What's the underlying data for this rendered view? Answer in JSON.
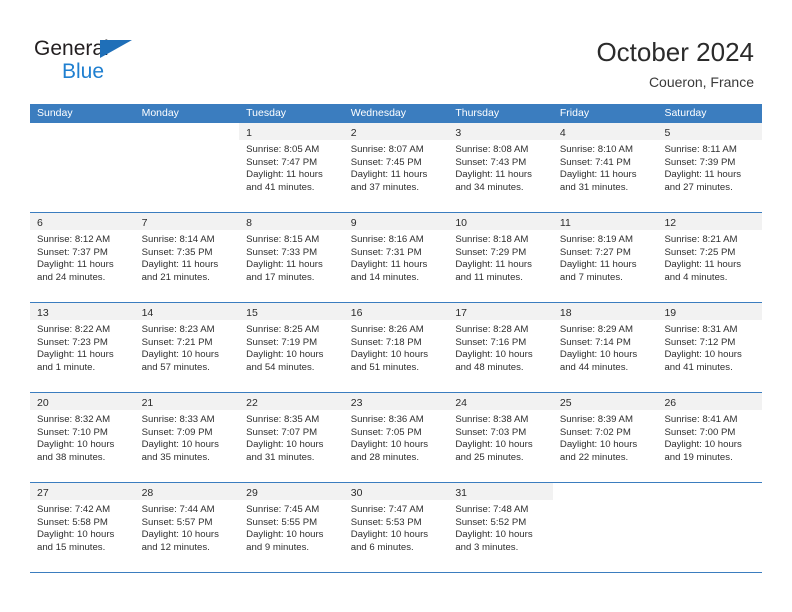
{
  "brand": {
    "name_part1": "General",
    "name_part2": "Blue",
    "triangle_color": "#1f6fb8",
    "blue_text_color": "#1f7fd0"
  },
  "header": {
    "title": "October 2024",
    "location": "Coueron, France"
  },
  "theme": {
    "header_blue": "#3b7dbf",
    "daynum_band": "#f2f2f2",
    "text": "#2f2f2f"
  },
  "weekdays": [
    "Sunday",
    "Monday",
    "Tuesday",
    "Wednesday",
    "Thursday",
    "Friday",
    "Saturday"
  ],
  "weeks": [
    [
      {
        "day": "",
        "sunrise": "",
        "sunset": "",
        "daylight1": "",
        "daylight2": ""
      },
      {
        "day": "",
        "sunrise": "",
        "sunset": "",
        "daylight1": "",
        "daylight2": ""
      },
      {
        "day": "1",
        "sunrise": "Sunrise: 8:05 AM",
        "sunset": "Sunset: 7:47 PM",
        "daylight1": "Daylight: 11 hours",
        "daylight2": "and 41 minutes."
      },
      {
        "day": "2",
        "sunrise": "Sunrise: 8:07 AM",
        "sunset": "Sunset: 7:45 PM",
        "daylight1": "Daylight: 11 hours",
        "daylight2": "and 37 minutes."
      },
      {
        "day": "3",
        "sunrise": "Sunrise: 8:08 AM",
        "sunset": "Sunset: 7:43 PM",
        "daylight1": "Daylight: 11 hours",
        "daylight2": "and 34 minutes."
      },
      {
        "day": "4",
        "sunrise": "Sunrise: 8:10 AM",
        "sunset": "Sunset: 7:41 PM",
        "daylight1": "Daylight: 11 hours",
        "daylight2": "and 31 minutes."
      },
      {
        "day": "5",
        "sunrise": "Sunrise: 8:11 AM",
        "sunset": "Sunset: 7:39 PM",
        "daylight1": "Daylight: 11 hours",
        "daylight2": "and 27 minutes."
      }
    ],
    [
      {
        "day": "6",
        "sunrise": "Sunrise: 8:12 AM",
        "sunset": "Sunset: 7:37 PM",
        "daylight1": "Daylight: 11 hours",
        "daylight2": "and 24 minutes."
      },
      {
        "day": "7",
        "sunrise": "Sunrise: 8:14 AM",
        "sunset": "Sunset: 7:35 PM",
        "daylight1": "Daylight: 11 hours",
        "daylight2": "and 21 minutes."
      },
      {
        "day": "8",
        "sunrise": "Sunrise: 8:15 AM",
        "sunset": "Sunset: 7:33 PM",
        "daylight1": "Daylight: 11 hours",
        "daylight2": "and 17 minutes."
      },
      {
        "day": "9",
        "sunrise": "Sunrise: 8:16 AM",
        "sunset": "Sunset: 7:31 PM",
        "daylight1": "Daylight: 11 hours",
        "daylight2": "and 14 minutes."
      },
      {
        "day": "10",
        "sunrise": "Sunrise: 8:18 AM",
        "sunset": "Sunset: 7:29 PM",
        "daylight1": "Daylight: 11 hours",
        "daylight2": "and 11 minutes."
      },
      {
        "day": "11",
        "sunrise": "Sunrise: 8:19 AM",
        "sunset": "Sunset: 7:27 PM",
        "daylight1": "Daylight: 11 hours",
        "daylight2": "and 7 minutes."
      },
      {
        "day": "12",
        "sunrise": "Sunrise: 8:21 AM",
        "sunset": "Sunset: 7:25 PM",
        "daylight1": "Daylight: 11 hours",
        "daylight2": "and 4 minutes."
      }
    ],
    [
      {
        "day": "13",
        "sunrise": "Sunrise: 8:22 AM",
        "sunset": "Sunset: 7:23 PM",
        "daylight1": "Daylight: 11 hours",
        "daylight2": "and 1 minute."
      },
      {
        "day": "14",
        "sunrise": "Sunrise: 8:23 AM",
        "sunset": "Sunset: 7:21 PM",
        "daylight1": "Daylight: 10 hours",
        "daylight2": "and 57 minutes."
      },
      {
        "day": "15",
        "sunrise": "Sunrise: 8:25 AM",
        "sunset": "Sunset: 7:19 PM",
        "daylight1": "Daylight: 10 hours",
        "daylight2": "and 54 minutes."
      },
      {
        "day": "16",
        "sunrise": "Sunrise: 8:26 AM",
        "sunset": "Sunset: 7:18 PM",
        "daylight1": "Daylight: 10 hours",
        "daylight2": "and 51 minutes."
      },
      {
        "day": "17",
        "sunrise": "Sunrise: 8:28 AM",
        "sunset": "Sunset: 7:16 PM",
        "daylight1": "Daylight: 10 hours",
        "daylight2": "and 48 minutes."
      },
      {
        "day": "18",
        "sunrise": "Sunrise: 8:29 AM",
        "sunset": "Sunset: 7:14 PM",
        "daylight1": "Daylight: 10 hours",
        "daylight2": "and 44 minutes."
      },
      {
        "day": "19",
        "sunrise": "Sunrise: 8:31 AM",
        "sunset": "Sunset: 7:12 PM",
        "daylight1": "Daylight: 10 hours",
        "daylight2": "and 41 minutes."
      }
    ],
    [
      {
        "day": "20",
        "sunrise": "Sunrise: 8:32 AM",
        "sunset": "Sunset: 7:10 PM",
        "daylight1": "Daylight: 10 hours",
        "daylight2": "and 38 minutes."
      },
      {
        "day": "21",
        "sunrise": "Sunrise: 8:33 AM",
        "sunset": "Sunset: 7:09 PM",
        "daylight1": "Daylight: 10 hours",
        "daylight2": "and 35 minutes."
      },
      {
        "day": "22",
        "sunrise": "Sunrise: 8:35 AM",
        "sunset": "Sunset: 7:07 PM",
        "daylight1": "Daylight: 10 hours",
        "daylight2": "and 31 minutes."
      },
      {
        "day": "23",
        "sunrise": "Sunrise: 8:36 AM",
        "sunset": "Sunset: 7:05 PM",
        "daylight1": "Daylight: 10 hours",
        "daylight2": "and 28 minutes."
      },
      {
        "day": "24",
        "sunrise": "Sunrise: 8:38 AM",
        "sunset": "Sunset: 7:03 PM",
        "daylight1": "Daylight: 10 hours",
        "daylight2": "and 25 minutes."
      },
      {
        "day": "25",
        "sunrise": "Sunrise: 8:39 AM",
        "sunset": "Sunset: 7:02 PM",
        "daylight1": "Daylight: 10 hours",
        "daylight2": "and 22 minutes."
      },
      {
        "day": "26",
        "sunrise": "Sunrise: 8:41 AM",
        "sunset": "Sunset: 7:00 PM",
        "daylight1": "Daylight: 10 hours",
        "daylight2": "and 19 minutes."
      }
    ],
    [
      {
        "day": "27",
        "sunrise": "Sunrise: 7:42 AM",
        "sunset": "Sunset: 5:58 PM",
        "daylight1": "Daylight: 10 hours",
        "daylight2": "and 15 minutes."
      },
      {
        "day": "28",
        "sunrise": "Sunrise: 7:44 AM",
        "sunset": "Sunset: 5:57 PM",
        "daylight1": "Daylight: 10 hours",
        "daylight2": "and 12 minutes."
      },
      {
        "day": "29",
        "sunrise": "Sunrise: 7:45 AM",
        "sunset": "Sunset: 5:55 PM",
        "daylight1": "Daylight: 10 hours",
        "daylight2": "and 9 minutes."
      },
      {
        "day": "30",
        "sunrise": "Sunrise: 7:47 AM",
        "sunset": "Sunset: 5:53 PM",
        "daylight1": "Daylight: 10 hours",
        "daylight2": "and 6 minutes."
      },
      {
        "day": "31",
        "sunrise": "Sunrise: 7:48 AM",
        "sunset": "Sunset: 5:52 PM",
        "daylight1": "Daylight: 10 hours",
        "daylight2": "and 3 minutes."
      },
      {
        "day": "",
        "sunrise": "",
        "sunset": "",
        "daylight1": "",
        "daylight2": ""
      },
      {
        "day": "",
        "sunrise": "",
        "sunset": "",
        "daylight1": "",
        "daylight2": ""
      }
    ]
  ]
}
